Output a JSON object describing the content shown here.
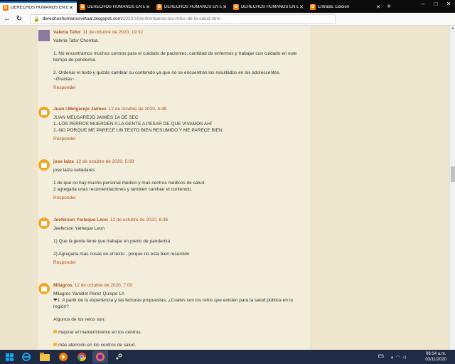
{
  "browser": {
    "tabs": [
      {
        "label": "DERECHOS HUMANOS EN EL",
        "active": true
      },
      {
        "label": "DERECHOS HUMANOS EN EL",
        "active": false
      },
      {
        "label": "DERECHOS HUMANOS EN EL",
        "active": false
      },
      {
        "label": "DERECHOS HUMANOS EN EL",
        "active": false
      },
      {
        "label": "Entrada: Edición",
        "active": false
      }
    ],
    "url_host": "derechoshumanosvirtual.blogspot.com",
    "url_path": "/2020/10/enfrentamos-los-retos-de-la-salud.html",
    "accent_color": "#0a84ff"
  },
  "comments": [
    {
      "author": "Valeria Tafur",
      "date": "11 de octubre de 2020, 19:32",
      "avatar": "photo",
      "lines": [
        "Valeria Tafur Chomba.",
        "",
        "1. No encontramos muchos centros para el cuidado de pacientes, cantidad de enfermos y trabajar con cuidado en este tiempo de pandemia.",
        "",
        "2. Ordenar el texto y quizás cambiar su contenido ya que no se encuentran los resultados en los adolescentes.",
        "~Gracias~"
      ],
      "reply": "Responder"
    },
    {
      "author": "Juan I.Melgarejo Jaimes",
      "date": "12 de octubre de 2020, 4:48",
      "avatar": "blogger",
      "lines": [
        "JUAN MELGAREJO JAIMES 1A DE SEC",
        "1.-LOS PERROS MUERDEN A LA GENTE A PESAR DE QUE VIVAMOS AHÍ",
        "2.-NO PORQUE ME PARECE UN TEXTO BIEN RESUMIDO Y ME PARECE BIEN"
      ],
      "reply": "Responder"
    },
    {
      "author": "jose laiza",
      "date": "12 de octubre de 2020, 5:09",
      "avatar": "blogger",
      "lines": [
        "jose laiza valladares",
        "",
        "1 de que no hay mucho personal medico y mas centros medicos de salud.",
        "2 agregaria unas recomendaciones y tambien cambiar el contenido."
      ],
      "reply": "Responder"
    },
    {
      "author": "Jeeferson Yarleque Leon",
      "date": "12 de octubre de 2020, 6:36",
      "avatar": "blogger",
      "lines": [
        "Jeeferson Yarleque Leon",
        "",
        "1) Que la gente tiene que trabajar en preno de pandemia",
        "",
        "2) Agregaria mas cosas en el texto , porque no esta bien resumido"
      ],
      "reply": "Responder"
    },
    {
      "author": "Milagros",
      "date": "12 de octubre de 2020, 7:00",
      "avatar": "blogger",
      "lines": [
        "Milagros Yamillet Perez Quispe 1A",
        "❤1.  A partir de tu experiencia y las lecturas propuestas, ¿Cuáles son los retos que existen para la salud pública en tu región?",
        "",
        "Algunos de los retos son:",
        "",
        "mejorar el mantenimiento en los centros.",
        "",
        "más atención en los centros de salud."
      ],
      "bullet_lines": [
        5,
        7
      ],
      "reply": "Responder"
    }
  ],
  "taskbar": {
    "icons": [
      "ie-icon",
      "folder-icon",
      "media-player-icon",
      "chrome-icon",
      "firefox-icon",
      "steam-icon"
    ],
    "lang": "ES",
    "time": "08:14 a.m.",
    "date": "03/11/2020"
  }
}
